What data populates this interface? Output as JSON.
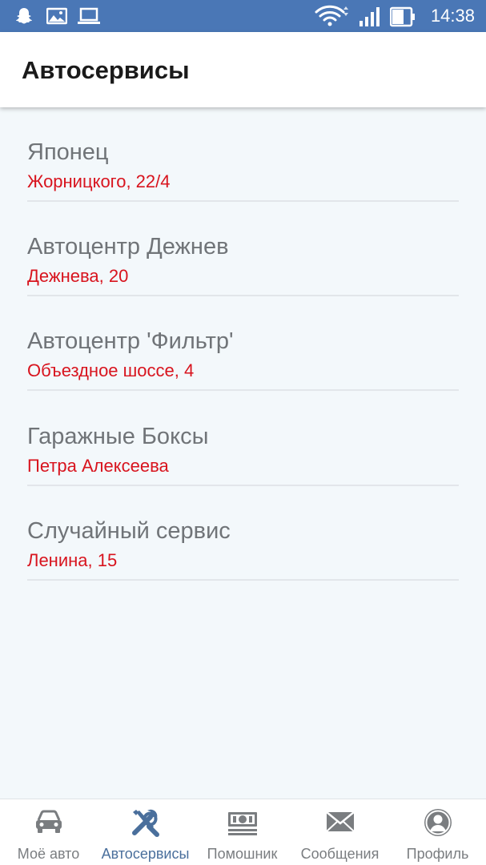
{
  "status_bar": {
    "time": "14:38",
    "icons": [
      "snapchat-icon",
      "gallery-icon",
      "laptop-icon",
      "wifi-icon",
      "signal-icon",
      "battery-icon"
    ]
  },
  "app_bar": {
    "title": "Автосервисы"
  },
  "services": [
    {
      "name": "Японец",
      "address": "Жорницкого, 22/4"
    },
    {
      "name": "Автоцентр Дежнев",
      "address": "Дежнева, 20"
    },
    {
      "name": "Автоцентр 'Фильтр'",
      "address": "Объездное шоссе, 4"
    },
    {
      "name": "Гаражные Боксы",
      "address": "Петра Алексеева"
    },
    {
      "name": "Случайный сервис",
      "address": "Ленина, 15"
    }
  ],
  "bottom_nav": {
    "items": [
      {
        "label": "Моё авто",
        "icon": "car-icon"
      },
      {
        "label": "Автосервисы",
        "icon": "tools-icon",
        "active": true
      },
      {
        "label": "Помошник",
        "icon": "money-icon"
      },
      {
        "label": "Сообщения",
        "icon": "envelope-icon"
      },
      {
        "label": "Профиль",
        "icon": "profile-icon"
      }
    ]
  },
  "colors": {
    "status_bar": "#4a77b6",
    "background": "#f3f8fb",
    "address": "#d8141e",
    "name": "#707478",
    "nav_active": "#4a6f9c",
    "nav_inactive": "#7a7d80"
  }
}
